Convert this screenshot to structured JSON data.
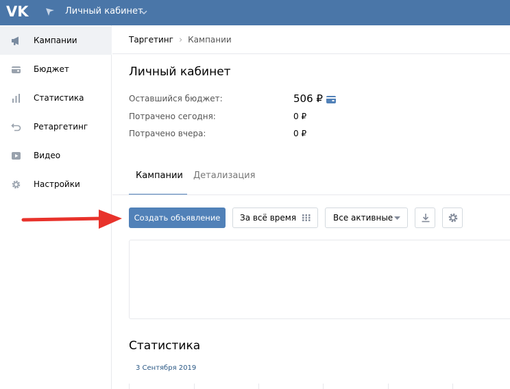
{
  "topbar": {
    "title": "Личный кабинет",
    "colors": {
      "background": "#4a76a8",
      "text": "#ffffff"
    }
  },
  "sidebar": {
    "items": [
      {
        "label": "Кампании",
        "icon": "megaphone-icon",
        "active": true
      },
      {
        "label": "Бюджет",
        "icon": "wallet-icon",
        "active": false
      },
      {
        "label": "Статистика",
        "icon": "bar-chart-icon",
        "active": false
      },
      {
        "label": "Ретаргетинг",
        "icon": "retarget-icon",
        "active": false
      },
      {
        "label": "Видео",
        "icon": "video-icon",
        "active": false
      },
      {
        "label": "Настройки",
        "icon": "gear-icon",
        "active": false
      }
    ]
  },
  "breadcrumb": {
    "first": "Таргетинг",
    "separator": "›",
    "second": "Кампании"
  },
  "page": {
    "title": "Личный кабинет"
  },
  "budget": {
    "remaining_label": "Оставшийся бюджет:",
    "remaining_value": "506 ₽",
    "spent_today_label": "Потрачено сегодня:",
    "spent_today_value": "0 ₽",
    "spent_yesterday_label": "Потрачено вчера:",
    "spent_yesterday_value": "0 ₽"
  },
  "tabs": [
    {
      "label": "Кампании",
      "active": true
    },
    {
      "label": "Детализация",
      "active": false
    }
  ],
  "toolbar": {
    "create_label": "Создать объявление",
    "period_label": "За всё время",
    "status_label": "Все активные",
    "download_icon": "download-icon",
    "settings_icon": "gear-icon"
  },
  "stats": {
    "title": "Статистика",
    "date": "3 Сентября 2019"
  },
  "colors": {
    "accent": "#5181b8",
    "annotation_arrow": "#e8322b"
  }
}
